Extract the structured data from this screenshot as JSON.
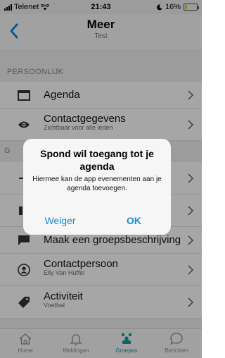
{
  "status_bar": {
    "carrier": "Telenet",
    "time": "21:43",
    "battery": "16%",
    "battery_level": 0.16
  },
  "header": {
    "title": "Meer",
    "subtitle": "Test"
  },
  "section": {
    "title": "PERSOONLIJK",
    "second_partial": "G"
  },
  "rows": [
    {
      "label": "Agenda",
      "sublabel": "",
      "icon": "calendar-icon"
    },
    {
      "label": "Contactgegevens",
      "sublabel": "Zichtbaar voor alle leden",
      "icon": "eye-icon"
    },
    {
      "label": "",
      "sublabel": "",
      "icon": "hidden-row-icon"
    },
    {
      "label": "",
      "sublabel": "",
      "icon": "hidden-row-icon"
    },
    {
      "label": "Maak een groepsbeschrijving",
      "sublabel": "",
      "icon": "chat-bubble-icon"
    },
    {
      "label": "Contactpersoon",
      "sublabel": "Elly Van Huffel",
      "icon": "contact-person-icon"
    },
    {
      "label": "Activiteit",
      "sublabel": "Voetbal",
      "icon": "tag-icon"
    }
  ],
  "alert": {
    "title": "Spond wil toegang tot je agenda",
    "message": "Hiermee kan de app evenementen aan je agenda toevoegen.",
    "deny_label": "Weiger",
    "ok_label": "OK"
  },
  "tabs": [
    {
      "label": "Home",
      "icon": "home-icon",
      "active": false
    },
    {
      "label": "Meldingen",
      "icon": "bell-icon",
      "active": false
    },
    {
      "label": "Groepen",
      "icon": "groups-icon",
      "active": true
    },
    {
      "label": "Berichten",
      "icon": "message-icon",
      "active": false
    }
  ],
  "colors": {
    "accent": "#1a8ad4",
    "active_tab": "#1a9aa0",
    "battery": "#f5c400"
  }
}
